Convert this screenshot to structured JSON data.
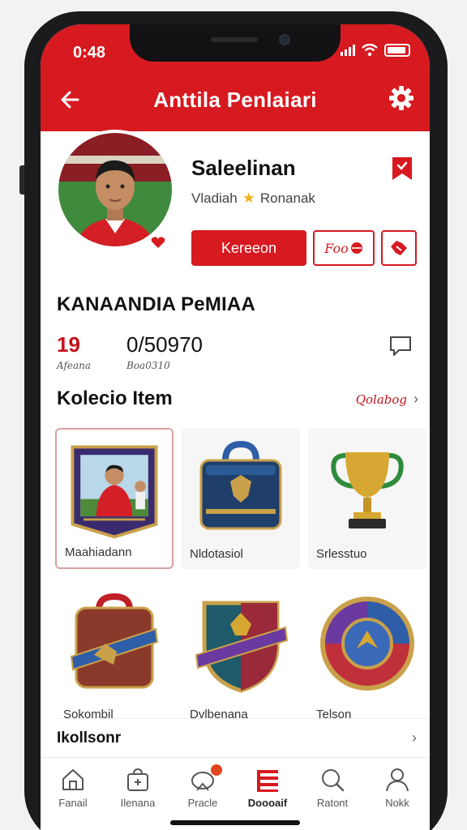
{
  "status_bar": {
    "time": "0:48"
  },
  "header": {
    "title": "Anttila Penlaiari"
  },
  "profile": {
    "name": "Saleelinan",
    "subtitle_left": "Vladiah",
    "subtitle_right": "Ronanak",
    "primary_button": "Kereeon",
    "secondary_button": "Foo"
  },
  "section_heading": "KANAANDIA PeMIAA",
  "stats": [
    {
      "value": "19",
      "label": "Afeana",
      "color": "#c3121b"
    },
    {
      "value": "0/50970",
      "label": "Boa0310",
      "color": "#111111"
    }
  ],
  "collection": {
    "title": "Kolecio Item",
    "see_all": "Qolabog",
    "items": [
      {
        "label": "Maahiadann",
        "icon": "player-card-icon"
      },
      {
        "label": "Nldotasiol",
        "icon": "bag-icon"
      },
      {
        "label": "Srlesstuo",
        "icon": "trophy-icon"
      },
      {
        "label": "Sokombil",
        "icon": "shield-bag-icon"
      },
      {
        "label": "Dvlbenana",
        "icon": "crest-icon"
      },
      {
        "label": "Telson",
        "icon": "badge-icon"
      }
    ]
  },
  "footer_section": {
    "title": "Ikollsonr"
  },
  "tabbar": {
    "items": [
      {
        "label": "Fanail",
        "icon": "home-icon"
      },
      {
        "label": "Ilenana",
        "icon": "bag-icon"
      },
      {
        "label": "Pracle",
        "icon": "stadium-icon"
      },
      {
        "label": "Doooaif",
        "icon": "list-icon"
      },
      {
        "label": "Ratont",
        "icon": "search-icon"
      },
      {
        "label": "Nokk",
        "icon": "user-icon"
      }
    ],
    "active_index": 3
  },
  "colors": {
    "brand_red": "#d71920",
    "accent_gold": "#f2b01e"
  }
}
